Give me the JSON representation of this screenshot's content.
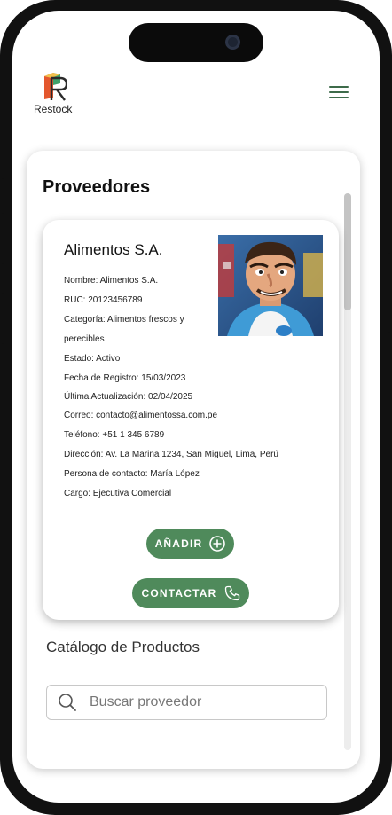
{
  "brand": {
    "name": "Restock"
  },
  "header": {
    "menu_icon": "hamburger-menu-icon"
  },
  "page": {
    "title": "Proveedores"
  },
  "supplier": {
    "name": "Alimentos S.A.",
    "photo_icon": "supplier-mascot-photo",
    "details": [
      "Nombre: Alimentos S.A.",
      "RUC: 20123456789",
      "Categoría: Alimentos frescos y",
      "perecibles",
      "Estado: Activo",
      "Fecha de Registro: 15/03/2023",
      "Última Actualización: 02/04/2025",
      "Correo: contacto@alimentossa.com.pe",
      "Teléfono: +51 1 345 6789",
      "Dirección: Av. La Marina 1234, San Miguel, Lima, Perú",
      "Persona de contacto: María López",
      "Cargo: Ejecutiva Comercial"
    ]
  },
  "actions": {
    "add_label": "AÑADIR",
    "add_icon": "plus-circle-icon",
    "contact_label": "CONTACTAR",
    "contact_icon": "phone-icon"
  },
  "catalog": {
    "title": "Catálogo de Productos"
  },
  "search": {
    "placeholder": "Buscar proveedor",
    "value": "",
    "icon": "search-icon"
  },
  "colors": {
    "accent": "#4f8a5b",
    "menu": "#3d6b4a"
  }
}
